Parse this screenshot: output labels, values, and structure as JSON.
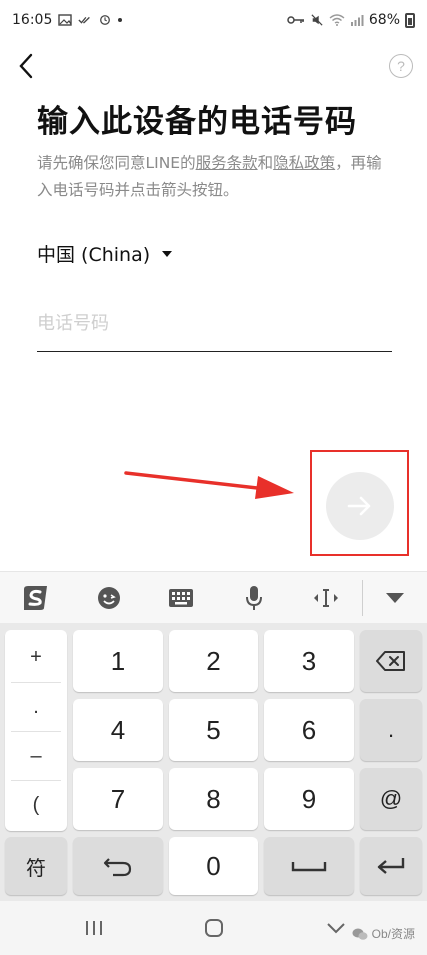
{
  "status_bar": {
    "time": "16:05",
    "battery_text": "68%"
  },
  "header": {
    "help_label": "?"
  },
  "main": {
    "title": "输入此设备的电话号码",
    "description": {
      "before": "请先确保您同意LINE的",
      "terms_link": "服务条款",
      "and": "和",
      "privacy_link": "隐私政策",
      "after": "，再输入电话号码并点击箭头按钮。"
    },
    "country": "中国 (China)",
    "phone_placeholder": "电话号码",
    "phone_value": ""
  },
  "annotation": {
    "color": "#e8302a"
  },
  "keyboard": {
    "symbols": [
      "+",
      ".",
      "–",
      "("
    ],
    "digits": [
      "1",
      "2",
      "3",
      "4",
      "5",
      "6",
      "7",
      "8",
      "9",
      "0"
    ],
    "dot_key": ".",
    "at_key": "@",
    "symbol_toggle": "符"
  },
  "watermark": {
    "text": "Ob/资源"
  },
  "colors": {
    "accent_annotation": "#e8302a",
    "next_button_disabled": "#ececec",
    "keyboard_bg": "#e9e9e9"
  }
}
